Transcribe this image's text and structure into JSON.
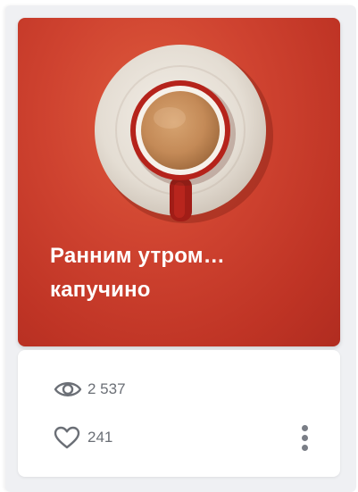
{
  "card": {
    "title": "Ранним утром… капучино",
    "image_icon": "coffee-cup-top-view",
    "colors": {
      "background": "#c9402e",
      "saucer": "#e6e0d8",
      "cup_rim": "#b8231c",
      "coffee": "#c98e5a",
      "text": "#ffffff"
    }
  },
  "stats": {
    "views_icon": "eye-icon",
    "views": "2 537",
    "likes_icon": "heart-icon",
    "likes": "241"
  },
  "actions": {
    "more_icon": "vertical-dots-icon"
  }
}
